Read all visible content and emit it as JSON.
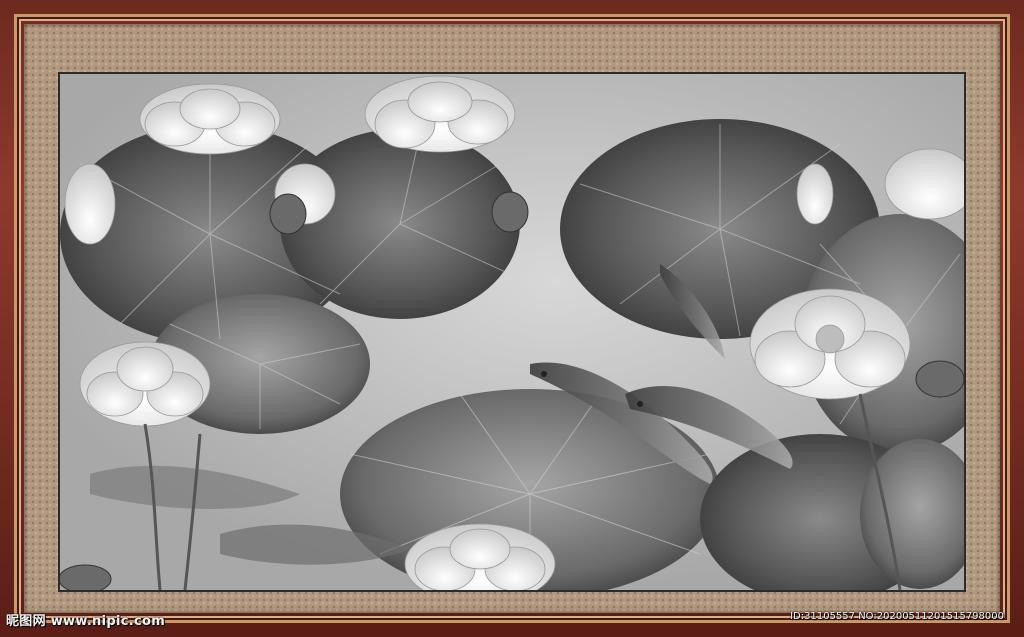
{
  "artwork": {
    "colors": {
      "frame": "#7a2e22",
      "mat": "#b19880",
      "paper": "#b9b9b9",
      "ink_dark": "#4a4a4a",
      "flower": "#e8e8e8"
    }
  },
  "watermark": {
    "site_label": "昵图网 www.nipic.com",
    "id_text": "ID:31105557 NO:20200511201515798000"
  }
}
